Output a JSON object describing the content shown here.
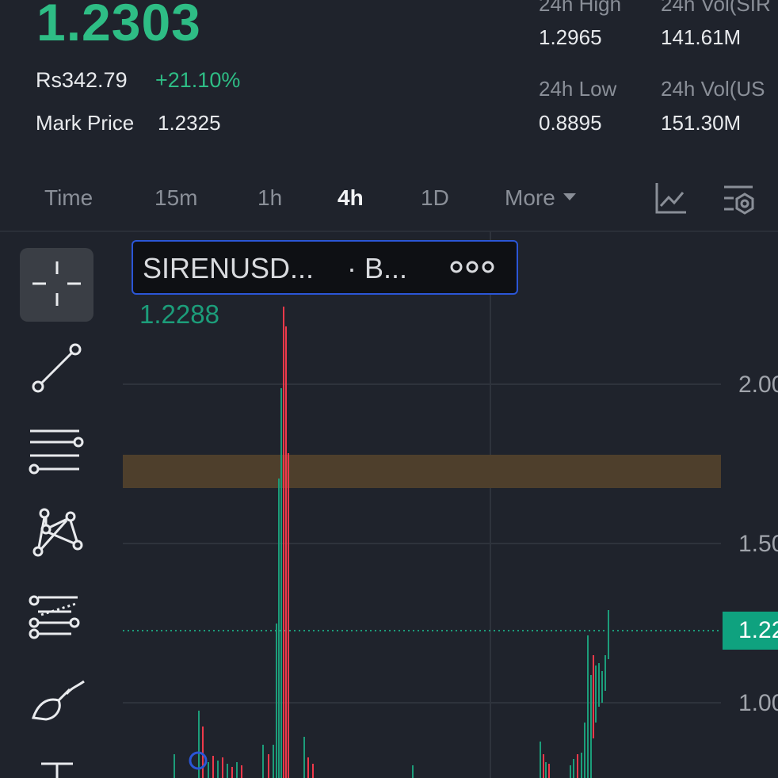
{
  "header": {
    "last_price": "1.2303",
    "fiat_price": "Rs342.79",
    "change_pct": "+21.10%",
    "mark_price_label": "Mark Price",
    "mark_price_value": "1.2325"
  },
  "stats": {
    "high_label": "24h High",
    "high_value": "1.2965",
    "vol_base_label": "24h Vol(SIR",
    "vol_base_value": "141.61M",
    "low_label": "24h Low",
    "low_value": "0.8895",
    "vol_quote_label": "24h Vol(US",
    "vol_quote_value": "151.30M"
  },
  "tabs": [
    {
      "label": "Time"
    },
    {
      "label": "15m"
    },
    {
      "label": "1h"
    },
    {
      "label": "4h",
      "active": true
    },
    {
      "label": "1D"
    },
    {
      "label": "More"
    }
  ],
  "toolbar_icons": [
    "indicator-chart-icon",
    "chart-settings-icon"
  ],
  "drawing_tools": [
    "crosshair-icon",
    "trend-line-icon",
    "horizontal-lines-icon",
    "pattern-icon",
    "fib-levels-icon",
    "brush-icon",
    "text-tool-icon"
  ],
  "chart": {
    "symbol_label": "SIRENUSD...",
    "symbol_sub": "· B...",
    "hover_value": "1.2288",
    "axis_labels": [
      "2.00",
      "1.50",
      "1.00"
    ],
    "current_price_tag": "1.22",
    "colors": {
      "up": "#1c9d7a",
      "down": "#f0394a",
      "zone": "#4e3f2c"
    }
  }
}
